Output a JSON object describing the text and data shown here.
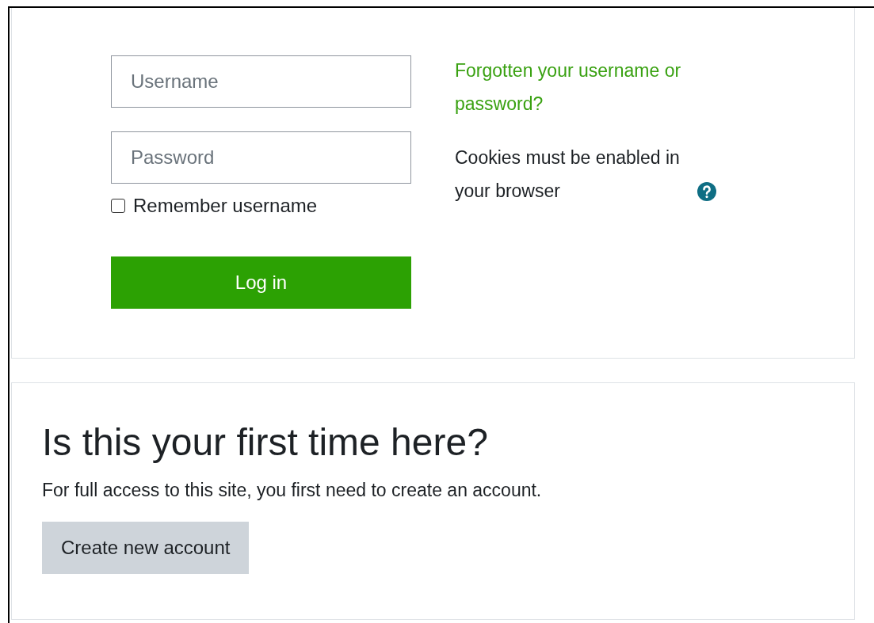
{
  "login": {
    "username": {
      "placeholder": "Username"
    },
    "password": {
      "placeholder": "Password"
    },
    "remember": {
      "label": "Remember username",
      "checked": false
    },
    "submit": "Log in",
    "forgot_link": "Forgotten your username or password?",
    "cookies_note": "Cookies must be enabled in your browser"
  },
  "signup": {
    "heading": "Is this your first time here?",
    "text": "For full access to this site, you first need to create an account.",
    "button": "Create new account"
  }
}
